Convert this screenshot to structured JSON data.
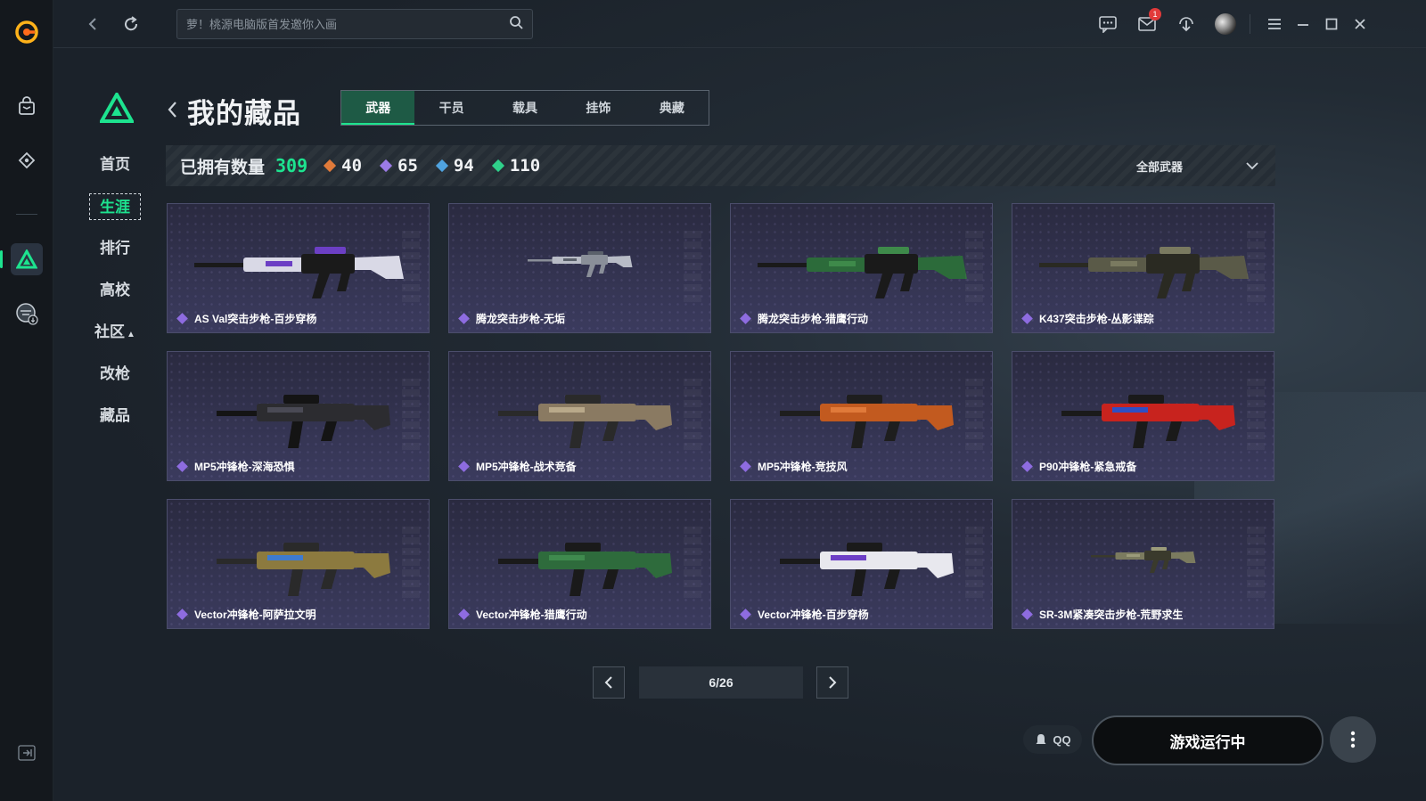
{
  "search": {
    "placeholder": "萝！桃源电脑版首发邀你入画"
  },
  "notifications": {
    "mail_badge": "1"
  },
  "sidebar": {
    "items": [
      {
        "label": "首页"
      },
      {
        "label": "生涯"
      },
      {
        "label": "排行"
      },
      {
        "label": "高校"
      },
      {
        "label": "社区"
      },
      {
        "label": "改枪"
      },
      {
        "label": "藏品"
      }
    ]
  },
  "header": {
    "title": "我的藏品",
    "tabs": [
      {
        "label": "武器",
        "active": true
      },
      {
        "label": "干员"
      },
      {
        "label": "载具"
      },
      {
        "label": "挂饰"
      },
      {
        "label": "典藏"
      }
    ]
  },
  "stats": {
    "owned_label": "已拥有数量",
    "owned_count": "309",
    "rarities": [
      {
        "count": "40",
        "color": "#e07a3a"
      },
      {
        "count": "65",
        "color": "#9b7be6"
      },
      {
        "count": "94",
        "color": "#4fa3e0"
      },
      {
        "count": "110",
        "color": "#2fd08a"
      }
    ],
    "filter_label": "全部武器"
  },
  "items": [
    {
      "name": "AS Val突击步枪-百步穿杨",
      "icon": "rifle-icon",
      "colors": [
        "#d9d9e6",
        "#1a1a1a",
        "#6c3fc4"
      ]
    },
    {
      "name": "腾龙突击步枪-无垢",
      "icon": "rifle-icon",
      "colors": [
        "#b8bcc6",
        "#8a8f99",
        "#5b616b"
      ]
    },
    {
      "name": "腾龙突击步枪-猎鹰行动",
      "icon": "rifle-icon",
      "colors": [
        "#2c6b3a",
        "#1a1a1a",
        "#3e8a4a"
      ]
    },
    {
      "name": "K437突击步枪-丛影谍踪",
      "icon": "rifle-icon",
      "colors": [
        "#5a5a48",
        "#2a2a22",
        "#7a7a60"
      ]
    },
    {
      "name": "MP5冲锋枪-深海恐惧",
      "icon": "smg-icon",
      "colors": [
        "#2c2c30",
        "#141414",
        "#4a4a55"
      ]
    },
    {
      "name": "MP5冲锋枪-战术竞备",
      "icon": "smg-icon",
      "colors": [
        "#8a7a62",
        "#2a2a2a",
        "#b9a98a"
      ]
    },
    {
      "name": "MP5冲锋枪-竞技风",
      "icon": "smg-icon",
      "colors": [
        "#c25a1f",
        "#1e1e1e",
        "#e07a3a"
      ]
    },
    {
      "name": "P90冲锋枪-紧急戒备",
      "icon": "smg-icon",
      "colors": [
        "#c8231e",
        "#1a1a1a",
        "#2f4fc4"
      ]
    },
    {
      "name": "Vector冲锋枪-阿萨拉文明",
      "icon": "smg-icon",
      "colors": [
        "#8c7a3f",
        "#2a2a2a",
        "#3e7bd0"
      ]
    },
    {
      "name": "Vector冲锋枪-猎鹰行动",
      "icon": "smg-icon",
      "colors": [
        "#2e6b3c",
        "#1a1a1a",
        "#3f8a4e"
      ]
    },
    {
      "name": "Vector冲锋枪-百步穿杨",
      "icon": "smg-icon",
      "colors": [
        "#e8e8ee",
        "#1a1a1a",
        "#6d3fc6"
      ]
    },
    {
      "name": "SR-3M紧凑突击步枪-荒野求生",
      "icon": "rifle-icon",
      "colors": [
        "#7b7b5f",
        "#3a3a2c",
        "#9b9b7a"
      ]
    }
  ],
  "pagination": {
    "indicator": "6/26"
  },
  "footer": {
    "qq_label": "QQ",
    "run_label": "游戏运行中"
  }
}
